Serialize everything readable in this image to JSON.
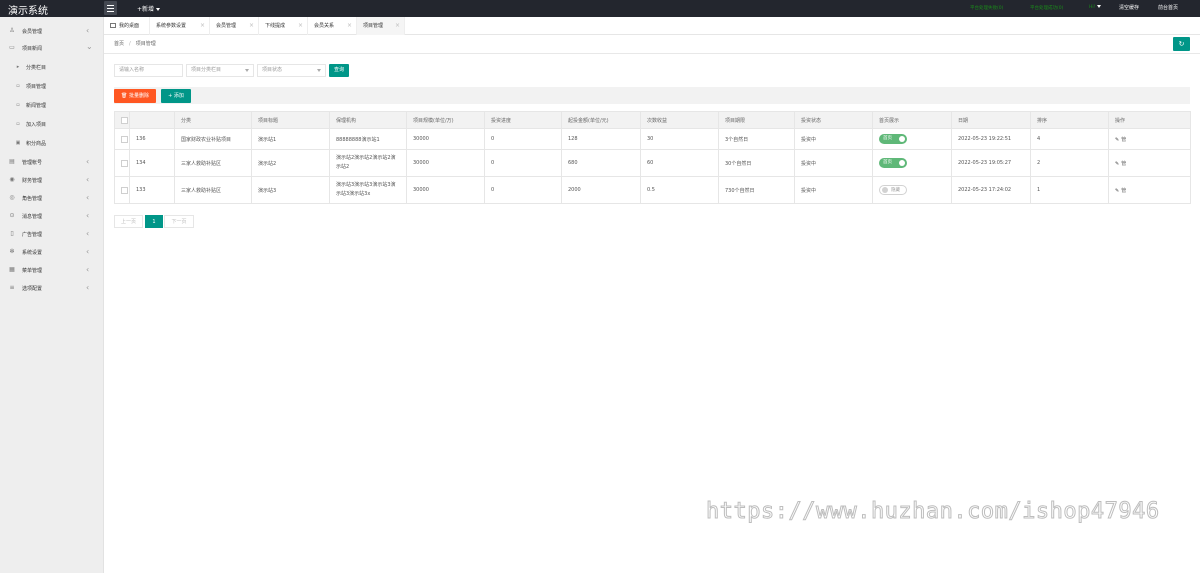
{
  "app": {
    "title": "演示系统"
  },
  "topbar": {
    "new_label": "+新增",
    "right_green_1": "平台处理失败(0)",
    "right_green_2": "平台处理成功(0)",
    "right_green_3": "Hi!",
    "clear_cache": "清空缓存",
    "front_home": "前台首页"
  },
  "sidebar": {
    "items": [
      {
        "label": "会员管理",
        "icon": "user-icon"
      },
      {
        "label": "项目新闻",
        "icon": "book-icon"
      },
      {
        "label": "分类栏目",
        "icon": "folder-icon",
        "sub": true
      },
      {
        "label": "项目管理",
        "icon": "grid-icon",
        "sub": true
      },
      {
        "label": "新闻管理",
        "icon": "grid-icon",
        "sub": true
      },
      {
        "label": "加入项目",
        "icon": "doc-icon",
        "sub": true
      },
      {
        "label": "积分商品",
        "icon": "gift-icon",
        "sub": true
      },
      {
        "label": "管理帐号",
        "icon": "account-icon"
      },
      {
        "label": "财务管理",
        "icon": "money-icon"
      },
      {
        "label": "角色管理",
        "icon": "role-icon"
      },
      {
        "label": "消息管理",
        "icon": "message-icon"
      },
      {
        "label": "广告管理",
        "icon": "ad-icon"
      },
      {
        "label": "系统设置",
        "icon": "gear-icon"
      },
      {
        "label": "菜单管理",
        "icon": "menu-icon"
      },
      {
        "label": "选项配置",
        "icon": "option-icon"
      }
    ]
  },
  "tabs": [
    {
      "label": "我的桌面"
    },
    {
      "label": "系统参数设置"
    },
    {
      "label": "会员管理"
    },
    {
      "label": "下线提成"
    },
    {
      "label": "会员关系"
    },
    {
      "label": "项目管理"
    }
  ],
  "breadcrumb": {
    "home": "首页",
    "current": "项目管理"
  },
  "filters": {
    "name_placeholder": "请输入名称",
    "category_placeholder": "项目分类栏目",
    "status_placeholder": "项目状态",
    "search_label": "查询"
  },
  "toolbar": {
    "delete_label": "批量删除",
    "add_label": "添加"
  },
  "table": {
    "headers": [
      "",
      "",
      "分类",
      "项目标题",
      "保理机构",
      "项目规模(单位/万)",
      "投资进度",
      "起投金额(单位/元)",
      "次数收益",
      "项目期限",
      "投资状态",
      "首页展示",
      "日期",
      "排序",
      "操作"
    ],
    "rows": [
      {
        "id": "136",
        "category": "国家财政农业补贴项目",
        "title": "演示站1",
        "org": "88888888演示站1",
        "scale": "30000",
        "progress": "0",
        "min_amount": "128",
        "income": "30",
        "term": "3个自然日",
        "status": "投资中",
        "home_show": "首页",
        "home_on": true,
        "date": "2022-05-23 19:22:51",
        "sort": "4",
        "edit_label": "管"
      },
      {
        "id": "134",
        "category": "三家人救助补贴区",
        "title": "演示站2",
        "org": "演示站2演示站2演示站2演示站2",
        "scale": "30000",
        "progress": "0",
        "min_amount": "680",
        "income": "60",
        "term": "30个自然日",
        "status": "投资中",
        "home_show": "首页",
        "home_on": true,
        "date": "2022-05-23 19:05:27",
        "sort": "2",
        "edit_label": "管"
      },
      {
        "id": "133",
        "category": "三家人救助补贴区",
        "title": "演示站3",
        "org": "演示站3演示站3演示站3演示站3演示站3x",
        "scale": "30000",
        "progress": "0",
        "min_amount": "2000",
        "income": "0.5",
        "term": "730个自然日",
        "status": "投资中",
        "home_show": "隐藏",
        "home_on": false,
        "date": "2022-05-23 17:24:02",
        "sort": "1",
        "edit_label": "管"
      }
    ]
  },
  "pagination": {
    "prev": "上一页",
    "current": "1",
    "next": "下一页"
  },
  "watermark": "https://www.huzhan.com/ishop47946",
  "colors": {
    "topbar": "#23262e",
    "primary": "#009688",
    "danger": "#ff5722",
    "switch_on": "#5fb878"
  }
}
